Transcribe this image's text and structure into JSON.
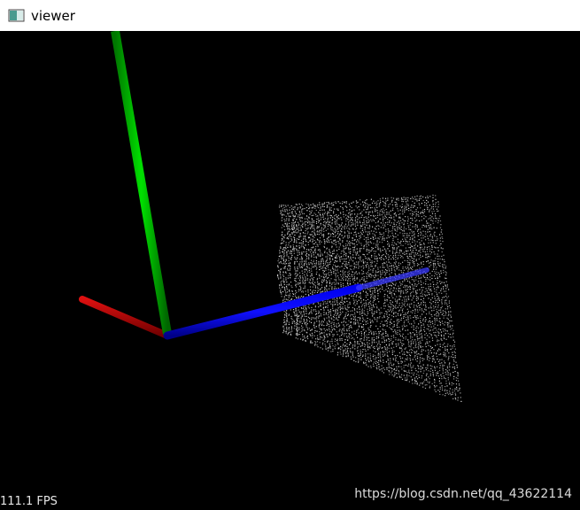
{
  "window": {
    "title": "viewer",
    "icon": "app-window-icon"
  },
  "viewer": {
    "background": "#000000",
    "fps_text": "111.1 FPS",
    "watermark": "https://blog.csdn.net/qq_43622114",
    "axes": {
      "x_color": "#cc0000",
      "y_color": "#00cc00",
      "z_color": "#0000ff"
    },
    "point_cloud_color": "#e0e0e0"
  }
}
